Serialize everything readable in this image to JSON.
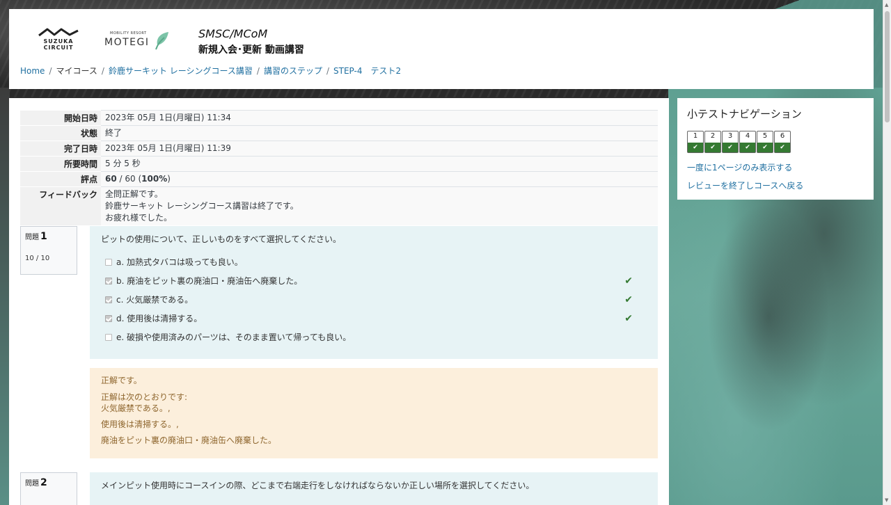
{
  "header": {
    "logo1_text": "SUZUKA\nCIRCUIT",
    "logo1_line1": "SUZUKA",
    "logo1_line2": "CIRCUIT",
    "logo2_small": "MOBILITY RESORT",
    "logo2_big": "MOTEGI",
    "title_line1": "SMSC/MCoM",
    "title_line2": "新規入会･更新 動画講習"
  },
  "breadcrumb": [
    {
      "label": "Home",
      "link": true
    },
    {
      "label": "マイコース",
      "link": false
    },
    {
      "label": "鈴鹿サーキット レーシングコース講習",
      "link": true
    },
    {
      "label": "講習のステップ",
      "link": true
    },
    {
      "label": "STEP-4　テスト2",
      "link": true
    }
  ],
  "summary": {
    "rows": [
      {
        "label": "開始日時",
        "value": "2023年 05月 1日(月曜日) 11:34"
      },
      {
        "label": "状態",
        "value": "終了"
      },
      {
        "label": "完了日時",
        "value": "2023年 05月 1日(月曜日) 11:39"
      },
      {
        "label": "所要時間",
        "value": "5 分 5 秒"
      }
    ],
    "grade_label": "評点",
    "grade_score": "60",
    "grade_rest": " / 60 (",
    "grade_pct": "100%",
    "grade_close": ")",
    "feedback_label": "フィードバック",
    "feedback_lines": [
      "全問正解です。",
      "鈴鹿サーキット レーシングコース講習は終了です。",
      "お疲れ様でした。"
    ]
  },
  "q1": {
    "label": "問題",
    "number": "1",
    "mark": "10 / 10",
    "text": "ピットの使用について、正しいものをすべて選択してください。",
    "options": [
      {
        "label": "a. 加熱式タバコは吸っても良い。",
        "checked": false,
        "correct": false
      },
      {
        "label": "b. 廃油をピット裏の廃油口・廃油缶へ廃棄した。",
        "checked": true,
        "correct": true
      },
      {
        "label": "c. 火気厳禁である。",
        "checked": true,
        "correct": true
      },
      {
        "label": "d. 使用後は清掃する。",
        "checked": true,
        "correct": true
      },
      {
        "label": "e. 破損や使用済みのパーツは、そのまま置いて帰っても良い。",
        "checked": false,
        "correct": false
      }
    ],
    "feedback_title": "正解です。",
    "right_answer_intro": "正解は次のとおりです:",
    "right_answers": [
      "火気厳禁である。,",
      "使用後は清掃する。,",
      "廃油をピット裏の廃油口・廃油缶へ廃棄した。"
    ]
  },
  "q2": {
    "label": "問題",
    "number": "2",
    "text": "メインピット使用時にコースインの際、どこまで右端走行をしなければならないか正しい場所を選択してください。"
  },
  "nav": {
    "title": "小テストナビゲーション",
    "buttons": [
      "1",
      "2",
      "3",
      "4",
      "5",
      "6"
    ],
    "link1": "一度に1ページのみ表示する",
    "link2": "レビューを終了しコースへ戻る"
  },
  "colors": {
    "link": "#1f6fa0",
    "correct_green": "#357a32",
    "question_bg": "#e7f3f5",
    "feedback_bg": "#fcefdc",
    "teal_bg": "#5fa092"
  }
}
